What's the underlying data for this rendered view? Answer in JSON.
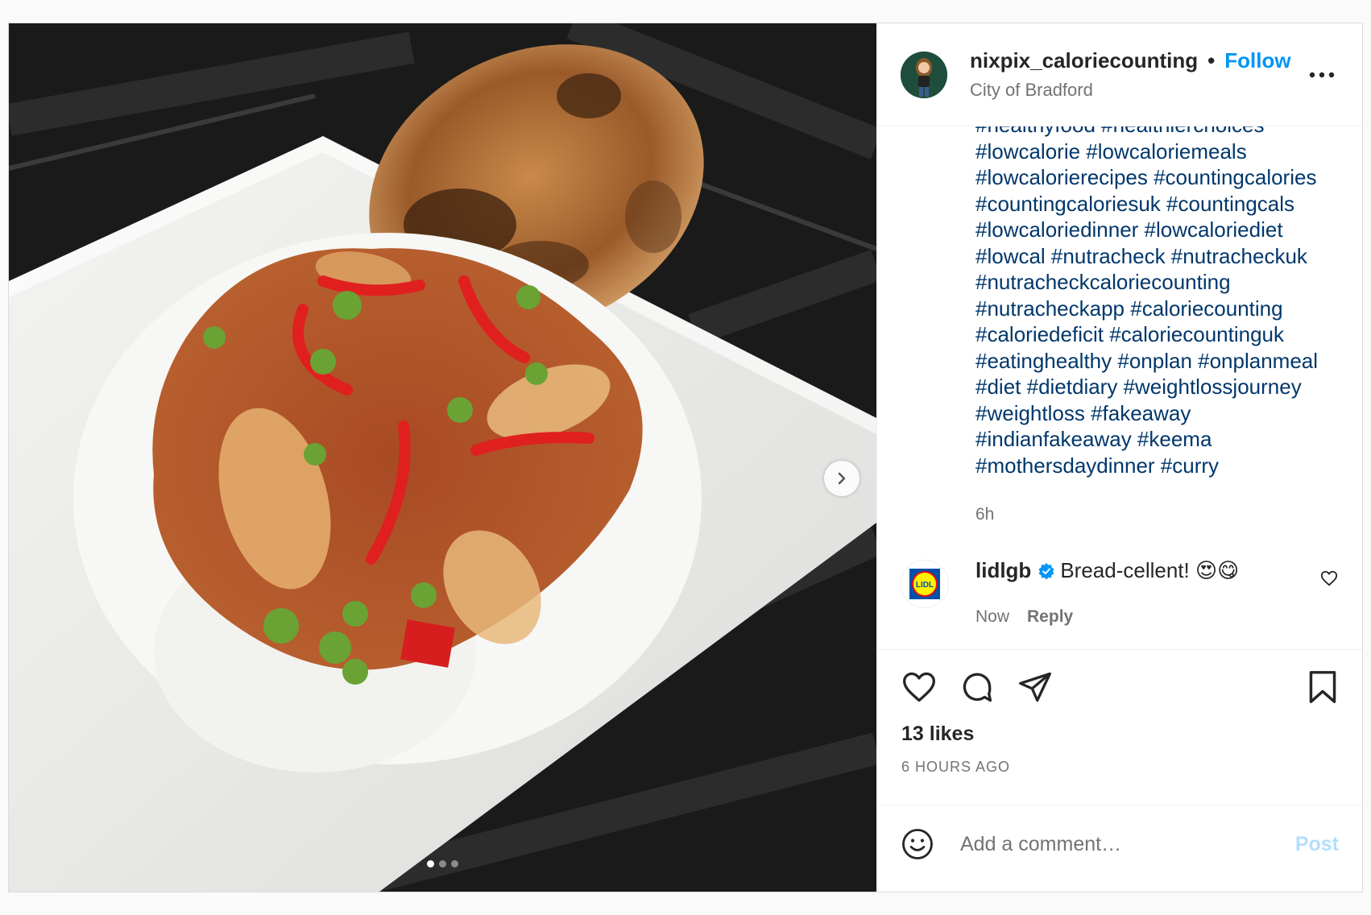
{
  "header": {
    "username": "nixpix_caloriecounting",
    "separator": "•",
    "follow_label": "Follow",
    "location": "City of Bradford"
  },
  "caption": {
    "lines": [
      "#healthyfood #healthierchoices",
      "#lowcalorie #lowcaloriemeals",
      "#lowcalorierecipes #countingcalories",
      "#countingcaloriesuk #countingcals",
      "#lowcaloriedinner #lowcaloriediet",
      "#lowcal #nutracheck #nutracheckuk",
      "#nutracheckcaloriecounting",
      "#nutracheckapp #caloriecounting",
      "#caloriedeficit #caloriecountinguk",
      "#eatinghealthy #onplan #onplanmeal",
      "#diet #dietdiary #weightlossjourney",
      "#weightloss #fakeaway",
      "#indianfakeaway #keema",
      "#mothersdaydinner #curry"
    ],
    "time": "6h"
  },
  "comment": {
    "username": "lidlgb",
    "text": "Bread-cellent! 😍😋",
    "time": "Now",
    "reply_label": "Reply",
    "avatar_logo": "LIDL"
  },
  "stats": {
    "likes": "13 likes",
    "time_ago": "6 HOURS AGO"
  },
  "add_comment": {
    "placeholder": "Add a comment…",
    "post_label": "Post"
  },
  "carousel": {
    "slide_count": 3,
    "active_index": 0
  },
  "icons": {
    "more": "more-horizontal-icon",
    "next": "chevron-right-icon",
    "like": "heart-icon",
    "comment": "comment-bubble-icon",
    "share": "paper-plane-icon",
    "save": "bookmark-icon",
    "emoji": "emoji-smile-icon",
    "verified": "verified-badge-icon"
  },
  "colors": {
    "accent": "#0095f6",
    "post_disabled": "#b2dffc",
    "hashtag": "#00376b",
    "muted": "#737373"
  }
}
